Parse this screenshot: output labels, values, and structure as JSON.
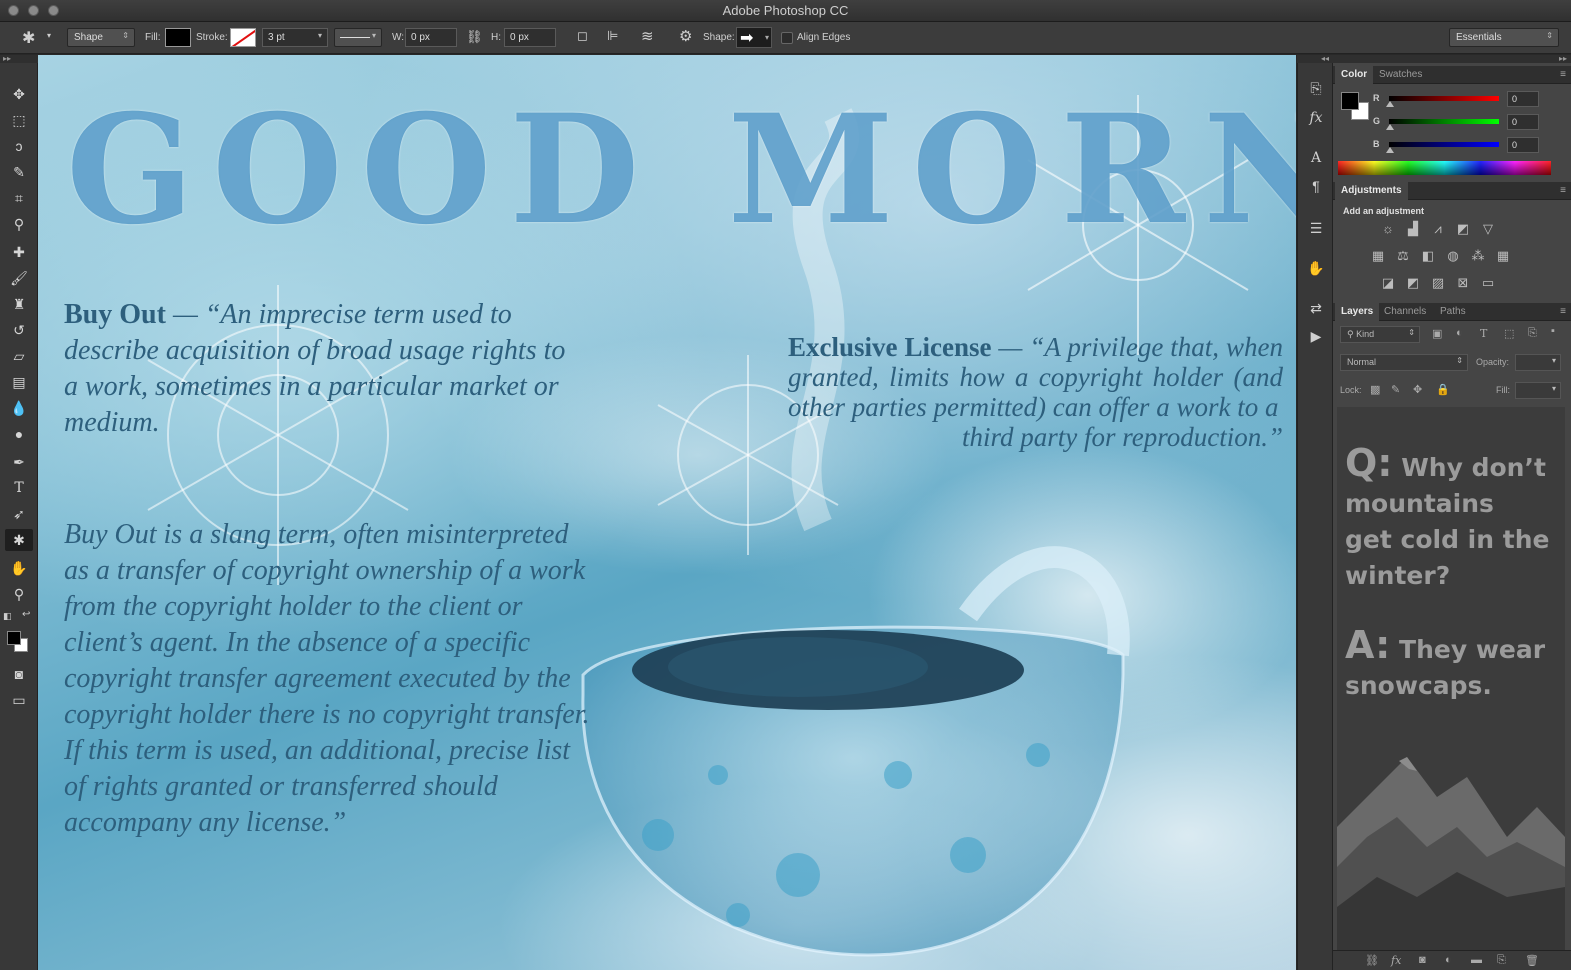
{
  "window": {
    "title": "Adobe Photoshop CC"
  },
  "options_bar": {
    "mode": "Shape",
    "fill_label": "Fill:",
    "stroke_label": "Stroke:",
    "stroke_width": "3 pt",
    "w_label": "W:",
    "w_value": "0 px",
    "h_label": "H:",
    "h_value": "0 px",
    "shape_label": "Shape:",
    "align_edges_label": "Align Edges",
    "workspace": "Essentials"
  },
  "canvas": {
    "headline": "GOOD MORNING!",
    "left_term": "Buy Out",
    "left_definition": " — “An imprecise term used to describe acquisition of broad usage rights to a work, sometimes in a particular market or medium.",
    "left_paragraph": "Buy Out is a slang term, often misinterpreted as a transfer of copyright ownership of a work from the copyright holder to the client or client’s agent. In the absence of a specific copyright transfer agreement executed by the copyright holder there is no copyright transfer. If this term is used, an additional, precise list of rights granted or transferred should accompany any license.”",
    "right_term": "Exclusive License",
    "right_definition": " — “A privilege that, when granted, limits how a copyright holder (and other parties permitted) can offer a work to a",
    "right_last_line": "third party for reproduction.”"
  },
  "color_panel": {
    "tabs": [
      "Color",
      "Swatches"
    ],
    "r_label": "R",
    "r_value": "0",
    "g_label": "G",
    "g_value": "0",
    "b_label": "B",
    "b_value": "0"
  },
  "adjustments_panel": {
    "tab": "Adjustments",
    "add_label": "Add an adjustment"
  },
  "layers_panel": {
    "tabs": [
      "Layers",
      "Channels",
      "Paths"
    ],
    "filter": "Kind",
    "blend_mode": "Normal",
    "opacity_label": "Opacity:",
    "lock_label": "Lock:",
    "fill_label": "Fill:",
    "joke_q_mark": "Q:",
    "joke_q_first": "Why don’t",
    "joke_q_rest": [
      "mountains",
      "get cold in the",
      "winter?"
    ],
    "joke_a_mark": "A:",
    "joke_a_first": "They wear",
    "joke_a_rest": [
      "snowcaps."
    ]
  },
  "colors": {
    "ui_dark": "#383838",
    "panel": "#454545",
    "canvas_text": "#2d5f7d",
    "headline": "#4691c3"
  }
}
